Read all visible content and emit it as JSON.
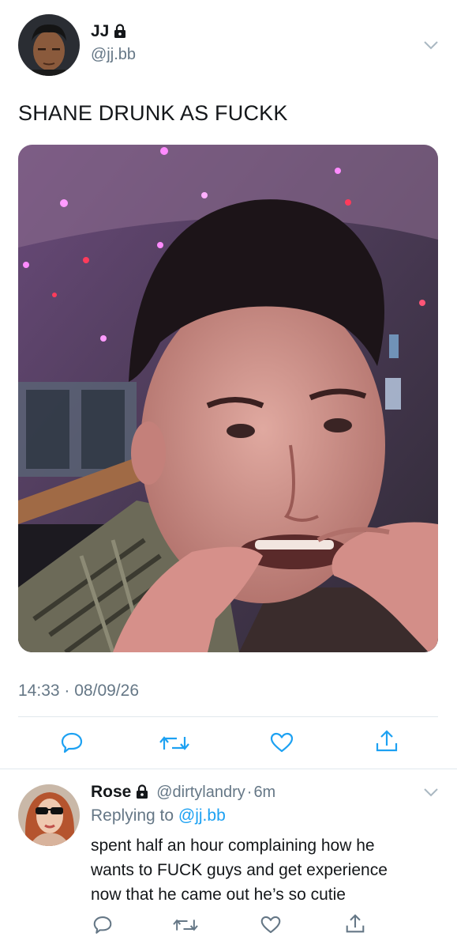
{
  "tweet": {
    "author_name": "JJ",
    "author_handle": "@jj.bb",
    "text": "SHANE DRUNK AS FUCKK",
    "time": "14:33",
    "separator": "·",
    "date": "08/09/26"
  },
  "reply": {
    "author_name": "Rose",
    "author_handle": "@dirtylandry",
    "separator": "·",
    "age": "6m",
    "replying_prefix": "Replying to ",
    "replying_handle": "@jj.bb",
    "text_lines": [
      "spent half an hour complaining how he",
      "wants to FUCK guys and get experience",
      "now that he came out he’s so cutie"
    ]
  },
  "icons": [
    "lock-icon",
    "chevron-down-icon",
    "reply-icon",
    "retweet-icon",
    "like-icon",
    "share-icon"
  ],
  "colors": {
    "accent": "#1da1f2",
    "secondary_text": "#657786",
    "divider": "#e1e8ed"
  }
}
